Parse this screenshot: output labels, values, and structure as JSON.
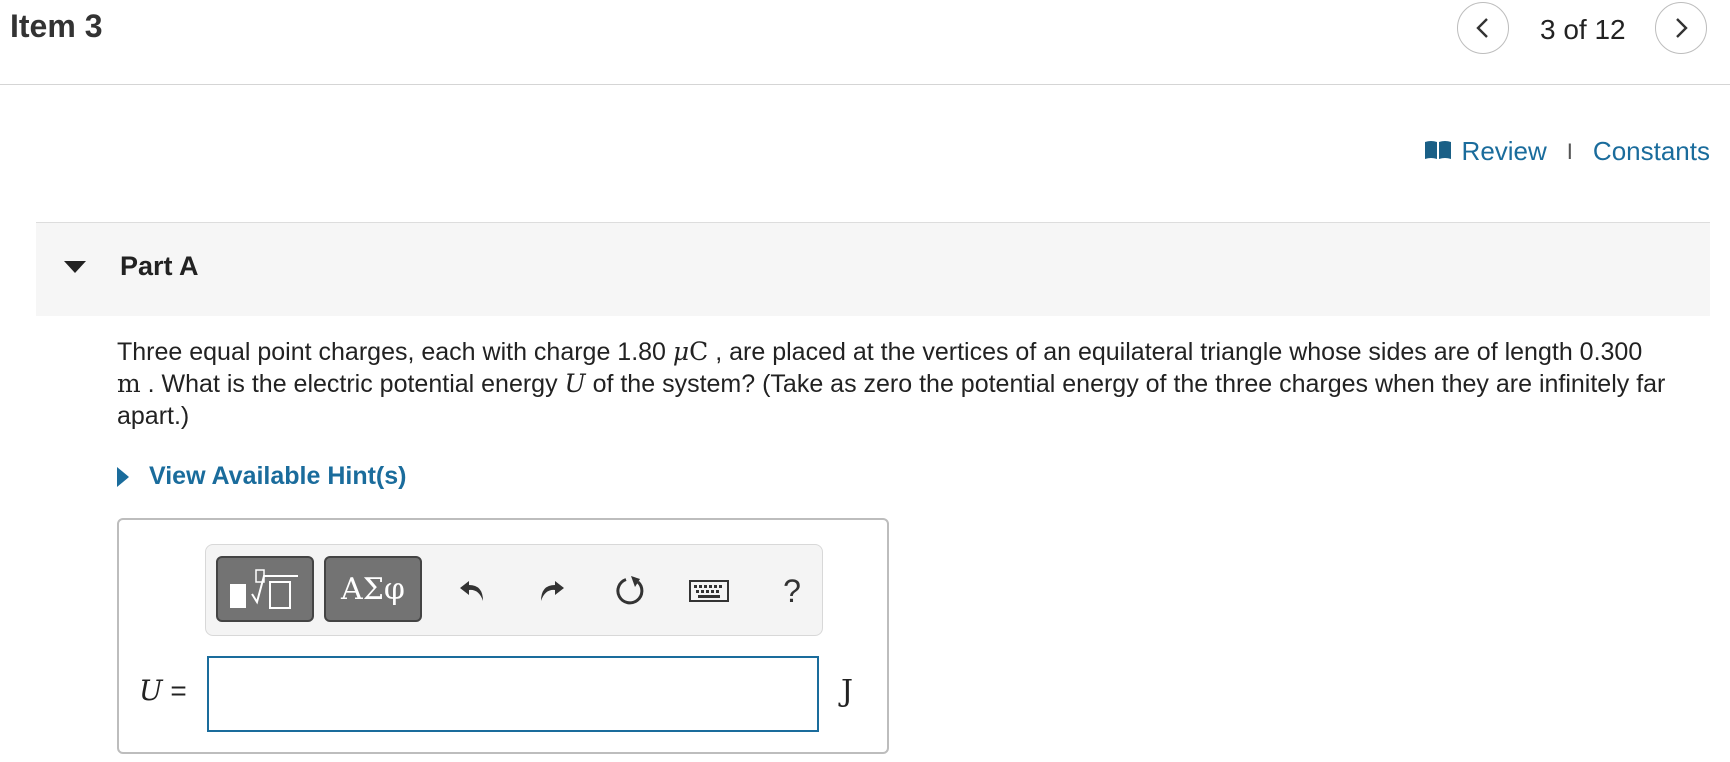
{
  "header": {
    "item_title": "Item 3",
    "counter": "3 of 12",
    "prev_icon": "chevron-left-icon",
    "next_icon": "chevron-right-icon"
  },
  "links": {
    "review": "Review",
    "separator": "I",
    "constants": "Constants",
    "review_icon": "book-icon"
  },
  "part": {
    "title": "Part A",
    "caret_icon": "caret-down-icon"
  },
  "question": {
    "text_1": "Three equal point charges, each with charge 1.80 ",
    "mu": "μ",
    "coulomb": "C",
    "text_2": " , are placed at the vertices of an equilateral triangle whose sides are of length 0.300",
    "meter": "m",
    "text_3": " . What is the electric potential energy ",
    "U": "U",
    "text_4": " of the system? (Take as zero the potential energy of the three charges when they are infinitely far apart.)"
  },
  "hint": {
    "label": "View Available Hint(s)"
  },
  "toolbar": {
    "greek_label": "ΑΣφ",
    "help_label": "?"
  },
  "answer": {
    "variable": "U",
    "equals": " =",
    "value": "",
    "unit": "J"
  },
  "colors": {
    "link": "#1a6c9c",
    "toolbar_button": "#737373",
    "input_border": "#1a6c9c"
  }
}
